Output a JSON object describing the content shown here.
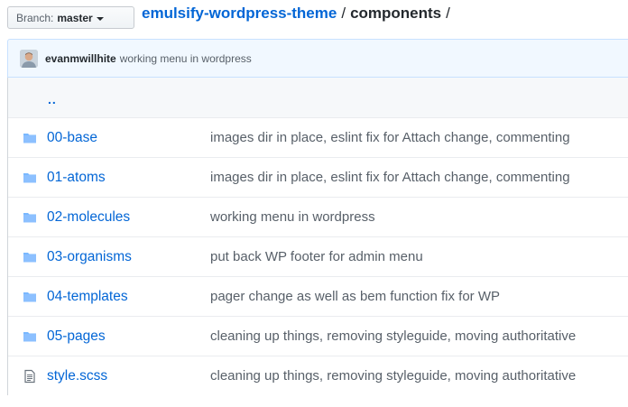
{
  "branch": {
    "prefix": "Branch:",
    "name": "master"
  },
  "breadcrumb": {
    "repo": "emulsify-wordpress-theme",
    "separator": "/",
    "folder": "components",
    "trailing": "/"
  },
  "latest_commit": {
    "author": "evanmwillhite",
    "message": "working menu in wordpress"
  },
  "parent_link": "..",
  "files": [
    {
      "name": "00-base",
      "type": "folder",
      "message": "images dir in place, eslint fix for Attach change, commenting"
    },
    {
      "name": "01-atoms",
      "type": "folder",
      "message": "images dir in place, eslint fix for Attach change, commenting"
    },
    {
      "name": "02-molecules",
      "type": "folder",
      "message": "working menu in wordpress"
    },
    {
      "name": "03-organisms",
      "type": "folder",
      "message": "put back WP footer for admin menu"
    },
    {
      "name": "04-templates",
      "type": "folder",
      "message": "pager change as well as bem function fix for WP"
    },
    {
      "name": "05-pages",
      "type": "folder",
      "message": "cleaning up things, removing styleguide, moving authoritative"
    },
    {
      "name": "style.scss",
      "type": "file",
      "message": "cleaning up things, removing styleguide, moving authoritative"
    }
  ],
  "colors": {
    "link": "#0366d6",
    "folder_icon": "#79b8ff",
    "file_icon": "#6a737d",
    "commit_bg": "#f1f8ff"
  }
}
